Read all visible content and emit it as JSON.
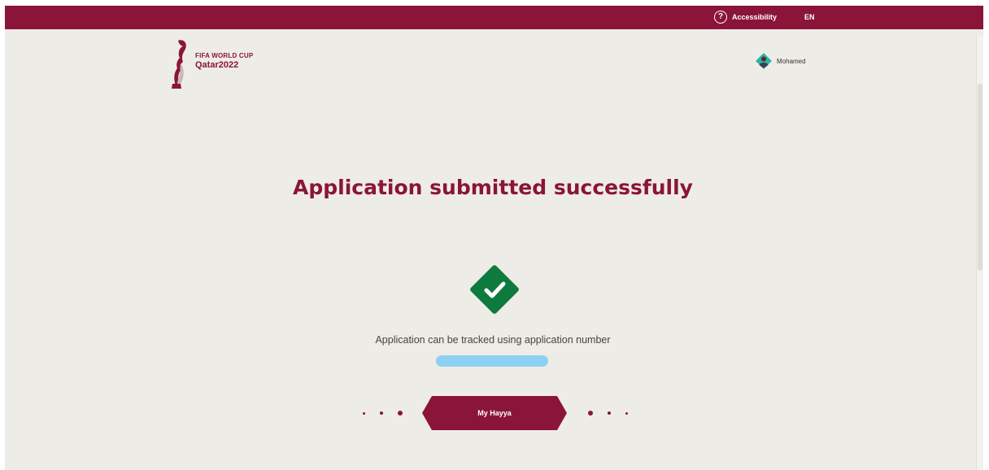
{
  "topbar": {
    "accessibility_label": "Accessibility",
    "language": "EN"
  },
  "logo": {
    "line1": "FIFA WORLD CUP",
    "line2": "Qatar2022"
  },
  "user": {
    "name": "Mohamed"
  },
  "main": {
    "title": "Application submitted successfully",
    "message_prefix": "Application can be tracked using application number",
    "primary_button": "My Hayya"
  },
  "colors": {
    "brand_maroon": "#8a1538",
    "success_green": "#0e7a3e",
    "page_background": "#eeece7",
    "redaction_blue": "#8ed0f4"
  },
  "icons": {
    "accessibility": "accessibility-icon",
    "trophy": "trophy-icon",
    "avatar": "avatar-icon",
    "success": "success-check-icon"
  }
}
